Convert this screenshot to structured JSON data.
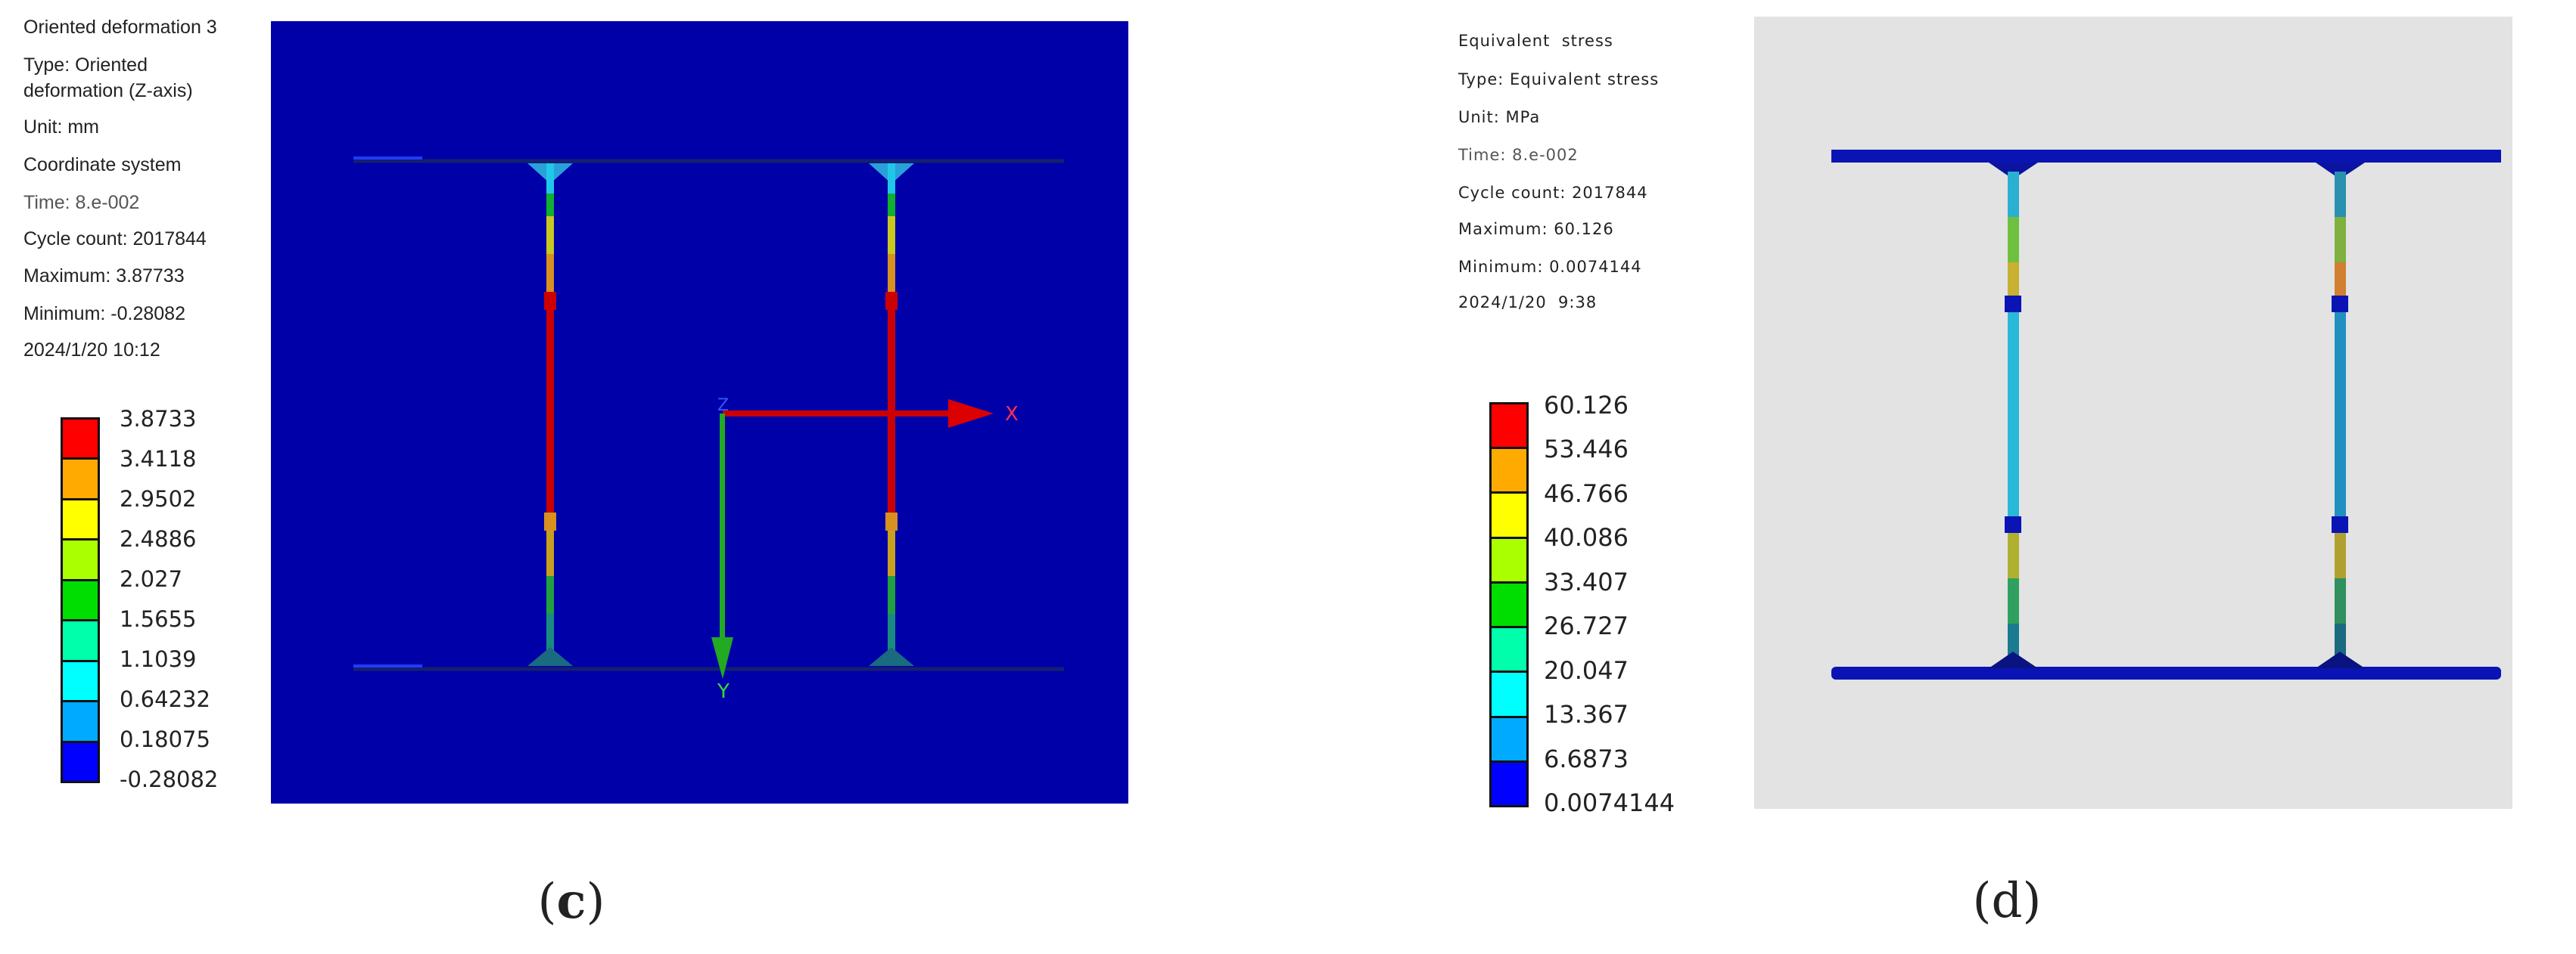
{
  "panel_c": {
    "caption_open": "(",
    "caption_letter": "c",
    "caption_close": ")",
    "info": [
      "Oriented deformation 3",
      "Type: Oriented",
      "deformation (Z-axis)",
      "Unit: mm",
      "Coordinate system",
      "Time: 8.e-002",
      "Cycle count: 2017844",
      "Maximum: 3.87733",
      "Minimum: -0.28082",
      "2024/1/20 10:12"
    ],
    "legend_labels": [
      "3.8733",
      "3.4118",
      "2.9502",
      "2.4886",
      "2.027",
      "1.5655",
      "1.1039",
      "0.64232",
      "0.18075",
      "-0.28082"
    ],
    "axis_labels": {
      "x": "X",
      "y": "Y",
      "z": "Z"
    },
    "background_color": "#0000a8"
  },
  "panel_d": {
    "caption_open": "(",
    "caption_letter": "d",
    "caption_close": ")",
    "info": [
      "Equivalent  stress",
      "Type: Equivalent stress",
      "Unit: MPa",
      "Time: 8.e-002",
      "Cycle count: 2017844",
      "Maximum: 60.126",
      "Minimum: 0.0074144",
      "2024/1/20  9:38"
    ],
    "legend_labels": [
      "60.126",
      "53.446",
      "46.766",
      "40.086",
      "33.407",
      "26.727",
      "20.047",
      "13.367",
      "6.6873",
      "0.0074144"
    ],
    "background_color": "#e3e3e3"
  },
  "legend_colors": [
    "#ff0000",
    "#ffaa00",
    "#ffff00",
    "#aaff00",
    "#00dd00",
    "#00ffaa",
    "#00ffff",
    "#00aaff",
    "#0000ff"
  ]
}
